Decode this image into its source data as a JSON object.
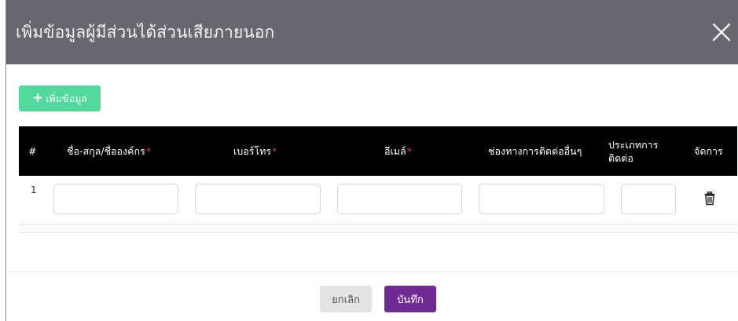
{
  "modal": {
    "title": "เพิ่มข้อมูลผู้มีส่วนได้ส่วนเสียภายนอก",
    "close_icon": "close-icon"
  },
  "toolbar": {
    "add_label": "เพิ่มข้อมูล",
    "add_icon": "plus-icon"
  },
  "table": {
    "columns": [
      {
        "label": "#",
        "required": false
      },
      {
        "label": "ชื่อ-สกุล/ชื่อองค์กร",
        "required": true
      },
      {
        "label": "เบอร์โทร",
        "required": true
      },
      {
        "label": "อีเมล์",
        "required": true
      },
      {
        "label": "ช่องทางการติดต่ออื่นๆ",
        "required": false
      },
      {
        "label_line1": "ประเภทการ",
        "label_line2": "ติดต่อ",
        "required": false
      },
      {
        "label": "จัดการ",
        "required": false
      }
    ],
    "required_mark": "*",
    "rows": [
      {
        "number": "1",
        "name": "",
        "phone": "",
        "email": "",
        "other_channel": "",
        "contact_type": "",
        "action_icon": "trash-icon"
      }
    ]
  },
  "footer": {
    "cancel_label": "ยกเลิก",
    "save_label": "บันทึก"
  },
  "colors": {
    "header_bg": "#6a6670",
    "add_button": "#52d89a",
    "table_header_bg": "#000000",
    "required_mark": "#e53935",
    "save_button": "#6f2b94",
    "cancel_button": "#e4e4e4"
  }
}
